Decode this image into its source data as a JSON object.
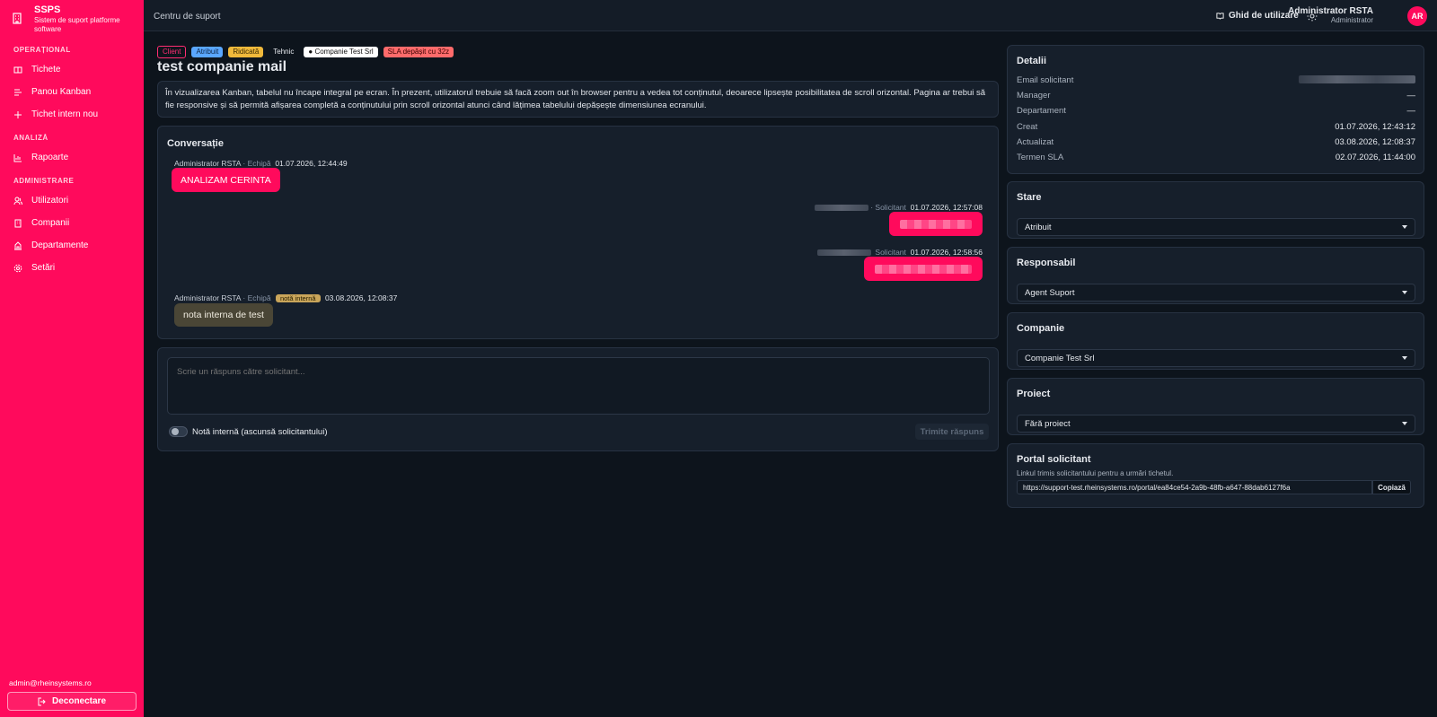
{
  "sidebar": {
    "brand_title": "SSPS",
    "brand_subtitle": "Sistem de suport platforme software",
    "sections": {
      "operational": "OPERAȚIONAL",
      "analysis": "ANALIZĂ",
      "admin": "ADMINISTRARE"
    },
    "items": {
      "tickets": "Tichete",
      "kanban": "Panou Kanban",
      "new_ticket": "Tichet intern nou",
      "reports": "Rapoarte",
      "users": "Utilizatori",
      "companies": "Companii",
      "departments": "Departamente",
      "settings": "Setări"
    },
    "email": "admin@rheinsystems.ro",
    "logout": "Deconectare"
  },
  "topbar": {
    "title": "Centru de suport",
    "guide": "Ghid de utilizare",
    "user_name": "Administrator RSTA",
    "user_role": "Administrator",
    "avatar": "AR"
  },
  "ticket": {
    "tags": {
      "client": "Client",
      "status": "Atribuit",
      "priority": "Ridicată",
      "category": "Tehnic",
      "company": "● Companie Test Srl",
      "sla": "SLA depășit cu 32z"
    },
    "title": "test companie mail",
    "description": "În vizualizarea Kanban, tabelul nu încape integral pe ecran. În prezent, utilizatorul trebuie să facă zoom out în browser pentru a vedea tot conținutul, deoarece lipsește posibilitatea de scroll orizontal. Pagina ar trebui să fie responsive și să permită afișarea completă a conținutului prin scroll orizontal atunci când lățimea tabelului depășește dimensiunea ecranului."
  },
  "conversation": {
    "title": "Conversație",
    "messages": [
      {
        "author": "Administrator RSTA",
        "role": "· Echipă",
        "time": "01.07.2026, 12:44:49",
        "text": "ANALIZAM CERINTA"
      },
      {
        "role": "· Solicitant",
        "time": "01.07.2026, 12:57:08"
      },
      {
        "role": "Solicitant",
        "time": "01.07.2026, 12:58:56"
      },
      {
        "author": "Administrator RSTA",
        "role": "· Echipă",
        "note": "notă internă",
        "time": "03.08.2026, 12:08:37",
        "text": "nota interna de test"
      }
    ]
  },
  "reply": {
    "placeholder": "Scrie un răspuns către solicitant...",
    "internal_note": "Notă internă (ascunsă solicitantului)",
    "send": "Trimite răspuns"
  },
  "details": {
    "title": "Detalii",
    "email_label": "Email solicitant",
    "manager_label": "Manager",
    "manager": "—",
    "department_label": "Departament",
    "department": "—",
    "created_label": "Creat",
    "created": "01.07.2026, 12:43:12",
    "updated_label": "Actualizat",
    "updated": "03.08.2026, 12:08:37",
    "sla_label": "Termen SLA",
    "sla": "02.07.2026, 11:44:00"
  },
  "status_panel": {
    "title": "Stare",
    "value": "Atribuit"
  },
  "assignee_panel": {
    "title": "Responsabil",
    "value": "Agent Suport"
  },
  "company_panel": {
    "title": "Companie",
    "value": "Companie Test Srl"
  },
  "project_panel": {
    "title": "Proiect",
    "value": "Fără proiect"
  },
  "portal": {
    "title": "Portal solicitant",
    "note": "Linkul trimis solicitantului pentru a urmări tichetul.",
    "url": "https://support-test.rheinsystems.ro/portal/ea84ce54-2a9b-48fb-a647-88dab6127f6a",
    "copy": "Copiază"
  },
  "colors": {
    "accent": "#ff0a5c",
    "background": "#0d141c",
    "card": "#161f2b"
  }
}
